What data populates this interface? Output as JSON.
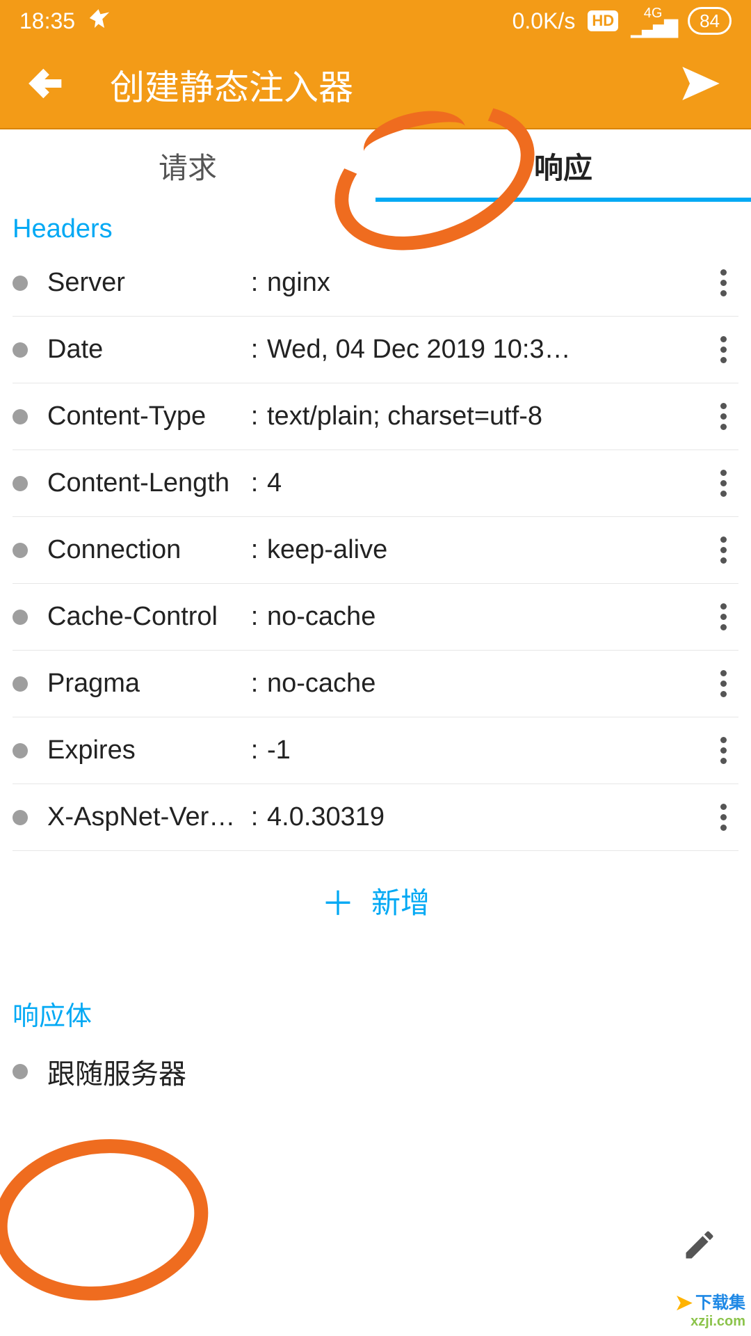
{
  "statusbar": {
    "time": "18:35",
    "speed": "0.0K/s",
    "hd": "HD",
    "net": "4G",
    "battery": "84"
  },
  "appbar": {
    "title": "创建静态注入器"
  },
  "tabs": {
    "request": "请求",
    "response": "响应"
  },
  "section_headers": "Headers",
  "headers": [
    {
      "key": "Server",
      "val": "nginx"
    },
    {
      "key": "Date",
      "val": "Wed, 04 Dec 2019 10:3…"
    },
    {
      "key": "Content-Type",
      "val": "text/plain; charset=utf-8"
    },
    {
      "key": "Content-Length",
      "val": "4"
    },
    {
      "key": "Connection",
      "val": "keep-alive"
    },
    {
      "key": "Cache-Control",
      "val": "no-cache"
    },
    {
      "key": "Pragma",
      "val": "no-cache"
    },
    {
      "key": "Expires",
      "val": "-1"
    },
    {
      "key": "X-AspNet-Ver…",
      "val": "4.0.30319"
    }
  ],
  "add_new": "新增",
  "section_body": "响应体",
  "body_value": "跟随服务器",
  "watermark": {
    "cn": "下载集",
    "url": "xzji.com"
  }
}
